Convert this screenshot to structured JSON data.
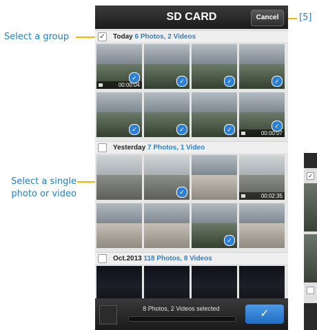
{
  "annotations": {
    "step_label": "[5]",
    "select_group": "Select a group",
    "select_single_line1": "Select a single",
    "select_single_line2": "photo or video"
  },
  "header": {
    "title": "SD CARD",
    "cancel_label": "Cancel"
  },
  "groups": [
    {
      "name": "Today",
      "count": "6 Photos, 2 Videos",
      "checked": true,
      "tiles": [
        {
          "kind": "land",
          "selected": true,
          "video_duration": "00:00:04"
        },
        {
          "kind": "land",
          "selected": true
        },
        {
          "kind": "land",
          "selected": true
        },
        {
          "kind": "land",
          "selected": true
        },
        {
          "kind": "land",
          "selected": true
        },
        {
          "kind": "land",
          "selected": true
        },
        {
          "kind": "land",
          "selected": true
        },
        {
          "kind": "land",
          "selected": true,
          "video_duration": "00:00:07"
        }
      ]
    },
    {
      "name": "Yesterday",
      "count": "7 Photos, 1 Video",
      "checked": false,
      "tiles": [
        {
          "kind": "sky",
          "selected": false
        },
        {
          "kind": "sky",
          "selected": true
        },
        {
          "kind": "city",
          "selected": false
        },
        {
          "kind": "sky",
          "selected": false,
          "video_duration": "00:02:35"
        },
        {
          "kind": "city",
          "selected": false
        },
        {
          "kind": "city",
          "selected": false
        },
        {
          "kind": "land",
          "selected": true
        },
        {
          "kind": "city",
          "selected": false
        }
      ]
    },
    {
      "name": "Oct.2013",
      "count": "118 Photos, 8 Videos",
      "checked": false,
      "tiles": [
        {
          "kind": "night",
          "selected": false
        },
        {
          "kind": "night",
          "selected": false
        },
        {
          "kind": "night",
          "selected": false
        },
        {
          "kind": "night",
          "selected": false
        }
      ]
    }
  ],
  "footer": {
    "selected_text": "8 Photos, 2 Videos selected"
  },
  "icons": {
    "checkbox_checked": "✓",
    "tile_check": "✓",
    "confirm": "✓"
  },
  "colors": {
    "accent": "#2e7fc4",
    "annotation_line": "#f5b400",
    "confirm": "#1f6cc4"
  }
}
